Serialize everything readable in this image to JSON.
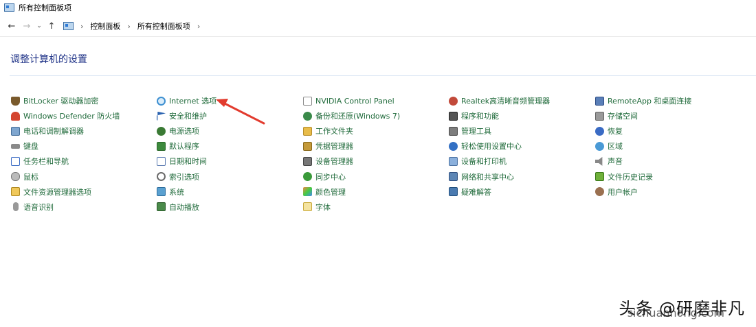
{
  "window": {
    "title": "所有控制面板项"
  },
  "nav": {
    "breadcrumb": [
      "控制面板",
      "所有控制面板项"
    ]
  },
  "page": {
    "heading": "调整计算机的设置"
  },
  "columns": [
    [
      {
        "label": "BitLocker 驱动器加密",
        "icon": "shield-icon",
        "cls": "shield"
      },
      {
        "label": "Windows Defender 防火墙",
        "icon": "firewall-icon",
        "cls": "defender"
      },
      {
        "label": "电话和调制解调器",
        "icon": "phone-modem-icon",
        "cls": "phone"
      },
      {
        "label": "键盘",
        "icon": "keyboard-icon",
        "cls": "keyboard"
      },
      {
        "label": "任务栏和导航",
        "icon": "taskbar-icon",
        "cls": "taskbar"
      },
      {
        "label": "鼠标",
        "icon": "mouse-icon",
        "cls": "mouse"
      },
      {
        "label": "文件资源管理器选项",
        "icon": "folder-options-icon",
        "cls": "folderopt"
      },
      {
        "label": "语音识别",
        "icon": "microphone-icon",
        "cls": "mic"
      }
    ],
    [
      {
        "label": "Internet 选项",
        "icon": "globe-icon",
        "cls": "globe"
      },
      {
        "label": "安全和维护",
        "icon": "flag-icon",
        "cls": "flag"
      },
      {
        "label": "电源选项",
        "icon": "power-icon",
        "cls": "power"
      },
      {
        "label": "默认程序",
        "icon": "default-programs-icon",
        "cls": "check"
      },
      {
        "label": "日期和时间",
        "icon": "calendar-icon",
        "cls": "calendar"
      },
      {
        "label": "索引选项",
        "icon": "search-icon",
        "cls": "search"
      },
      {
        "label": "系统",
        "icon": "system-icon",
        "cls": "system"
      },
      {
        "label": "自动播放",
        "icon": "autoplay-icon",
        "cls": "autoplay"
      }
    ],
    [
      {
        "label": "NVIDIA Control Panel",
        "icon": "document-icon",
        "cls": "doc"
      },
      {
        "label": "备份和还原(Windows 7)",
        "icon": "backup-icon",
        "cls": "backup"
      },
      {
        "label": "工作文件夹",
        "icon": "folder-icon",
        "cls": "folder"
      },
      {
        "label": "凭据管理器",
        "icon": "vault-icon",
        "cls": "vault"
      },
      {
        "label": "设备管理器",
        "icon": "device-manager-icon",
        "cls": "device"
      },
      {
        "label": "同步中心",
        "icon": "sync-icon",
        "cls": "sync"
      },
      {
        "label": "颜色管理",
        "icon": "color-icon",
        "cls": "color"
      },
      {
        "label": "字体",
        "icon": "font-icon",
        "cls": "font"
      }
    ],
    [
      {
        "label": "Realtek高清晰音频管理器",
        "icon": "audio-icon",
        "cls": "sound"
      },
      {
        "label": "程序和功能",
        "icon": "programs-icon",
        "cls": "program"
      },
      {
        "label": "管理工具",
        "icon": "tools-icon",
        "cls": "tools"
      },
      {
        "label": "轻松使用设置中心",
        "icon": "ease-of-access-icon",
        "cls": "ease"
      },
      {
        "label": "设备和打印机",
        "icon": "printer-icon",
        "cls": "printer"
      },
      {
        "label": "网络和共享中心",
        "icon": "network-icon",
        "cls": "network"
      },
      {
        "label": "疑难解答",
        "icon": "troubleshoot-icon",
        "cls": "trouble"
      }
    ],
    [
      {
        "label": "RemoteApp 和桌面连接",
        "icon": "remote-desktop-icon",
        "cls": "remote"
      },
      {
        "label": "存储空间",
        "icon": "storage-icon",
        "cls": "storage"
      },
      {
        "label": "恢复",
        "icon": "recovery-icon",
        "cls": "restore"
      },
      {
        "label": "区域",
        "icon": "region-icon",
        "cls": "region"
      },
      {
        "label": "声音",
        "icon": "speaker-icon",
        "cls": "speaker"
      },
      {
        "label": "文件历史记录",
        "icon": "file-history-icon",
        "cls": "history"
      },
      {
        "label": "用户帐户",
        "icon": "users-icon",
        "cls": "users"
      }
    ]
  ],
  "watermark": {
    "text": "头条 @研磨非凡",
    "url": "sichuanhong.com"
  }
}
